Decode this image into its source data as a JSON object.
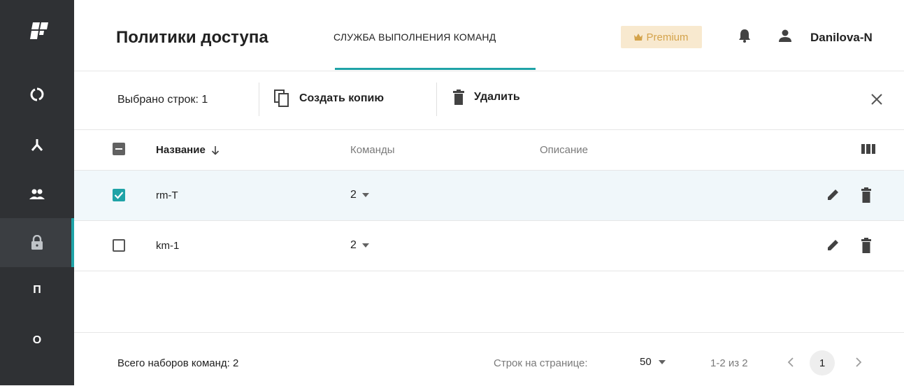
{
  "sidebar": {
    "items": [
      {
        "icon": "circle-arrows-icon",
        "label": ""
      },
      {
        "icon": "hierarchy-icon",
        "label": ""
      },
      {
        "icon": "users-icon",
        "label": ""
      },
      {
        "icon": "lock-icon",
        "label": "",
        "active": true
      },
      {
        "letter": "П"
      },
      {
        "letter": "О"
      }
    ]
  },
  "header": {
    "title": "Политики доступа",
    "tab": "СЛУЖБА ВЫПОЛНЕНИЯ КОМАНД",
    "premium": "Premium",
    "username": "Danilova-N"
  },
  "actions": {
    "selected_count": "Выбрано строк: 1",
    "copy_label": "Создать копию",
    "delete_label": "Удалить"
  },
  "table": {
    "columns": [
      "Название",
      "Команды",
      "Описание"
    ],
    "rows": [
      {
        "name": "rm-T",
        "commands": "2",
        "description": "",
        "selected": true
      },
      {
        "name": "km-1",
        "commands": "2",
        "description": "",
        "selected": false
      }
    ]
  },
  "footer": {
    "total": "Всего наборов команд: 2",
    "rows_per_page_label": "Строк на странице:",
    "rows_per_page_value": "50",
    "range": "1-2 из 2",
    "page": "1"
  },
  "colors": {
    "sidebar": "#2f3134",
    "accent": "#1fa3a7",
    "premium_bg": "#f8e9cf",
    "premium_text": "#d4a34b"
  }
}
